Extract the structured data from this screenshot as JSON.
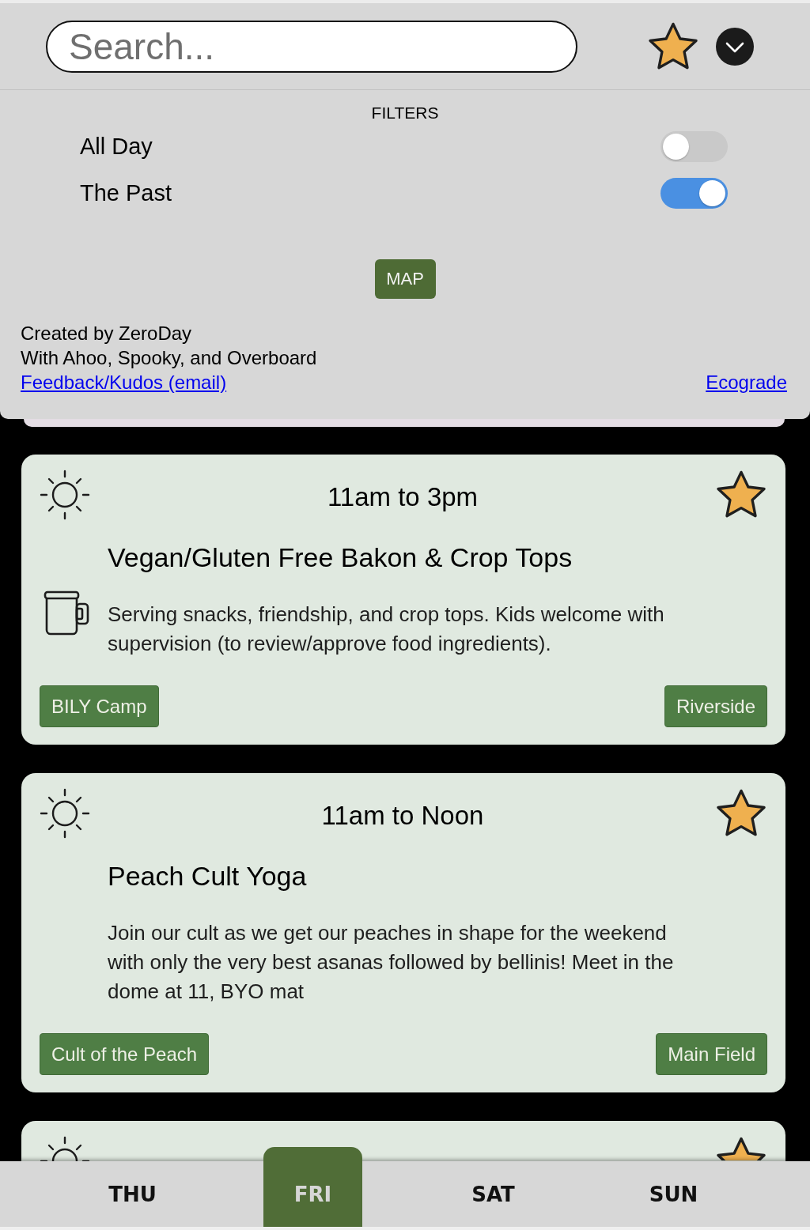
{
  "search": {
    "placeholder": "Search..."
  },
  "filters": {
    "title": "FILTERS",
    "items": [
      {
        "label": "All Day",
        "on": false
      },
      {
        "label": "The Past",
        "on": true
      }
    ]
  },
  "map_button": {
    "label": "MAP"
  },
  "credits": {
    "lines": [
      "Created by ZeroDay",
      "With Ahoo, Spooky, and Overboard"
    ],
    "feedback_link": "Feedback/Kudos (email)",
    "ecograde_link": "Ecograde"
  },
  "events": [
    {
      "time": "11am to 3pm",
      "starred": true,
      "title": "Vegan/Gluten Free Bakon & Crop Tops",
      "kind": "food",
      "description": "Serving snacks, friendship, and crop tops. Kids welcome with supervision (to review/approve food ingredients).",
      "tags": [
        "BILY Camp",
        "Riverside"
      ]
    },
    {
      "time": "11am to Noon",
      "starred": true,
      "title": "Peach Cult Yoga",
      "kind": "activity",
      "description": "Join our cult as we get our peaches in shape for the weekend with only the very best asanas followed by bellinis! Meet in the dome at 11, BYO mat",
      "tags": [
        "Cult of the Peach",
        "Main Field"
      ]
    },
    {
      "starred": true
    }
  ],
  "day_tabs": [
    {
      "label": "THU",
      "selected": false
    },
    {
      "label": "FRI",
      "selected": true
    },
    {
      "label": "SAT",
      "selected": false
    },
    {
      "label": "SUN",
      "selected": false
    }
  ]
}
